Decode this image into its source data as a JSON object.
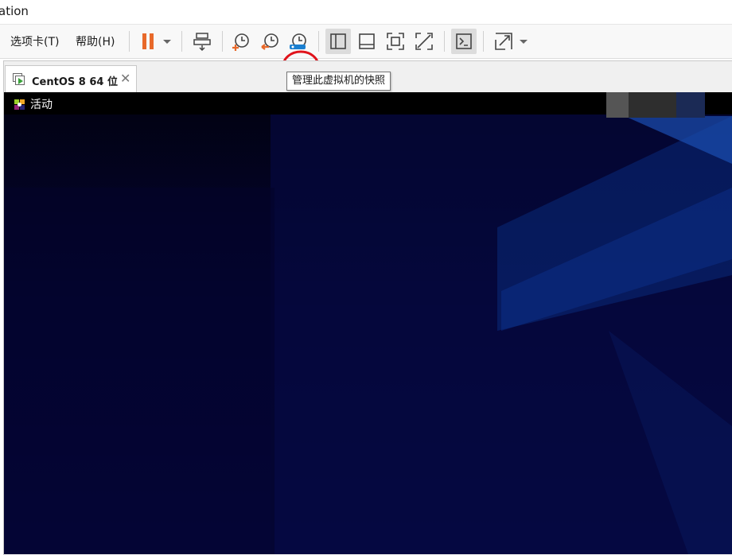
{
  "window": {
    "title": "ation"
  },
  "menu": {
    "tabs_label": "选项卡(T)",
    "help_label": "帮助(H)"
  },
  "toolbar": {
    "icons": [
      "pause-icon",
      "send-ctrl-alt-del-icon",
      "take-snapshot-icon",
      "revert-snapshot-icon",
      "snapshot-manager-icon",
      "show-library-icon",
      "show-thumbnail-icon",
      "full-screen-icon",
      "unity-icon",
      "console-icon",
      "stretch-icon"
    ],
    "tooltip": "管理此虚拟机的快照"
  },
  "tab": {
    "label": "CentOS 8 64 位",
    "close": "✕"
  },
  "guest": {
    "activities_label": "活动"
  },
  "colors": {
    "pause": "#e8692a",
    "snapshot_accent": "#1a7fd0",
    "annotation": "#e0131b",
    "guest_bg": "#04063a"
  }
}
